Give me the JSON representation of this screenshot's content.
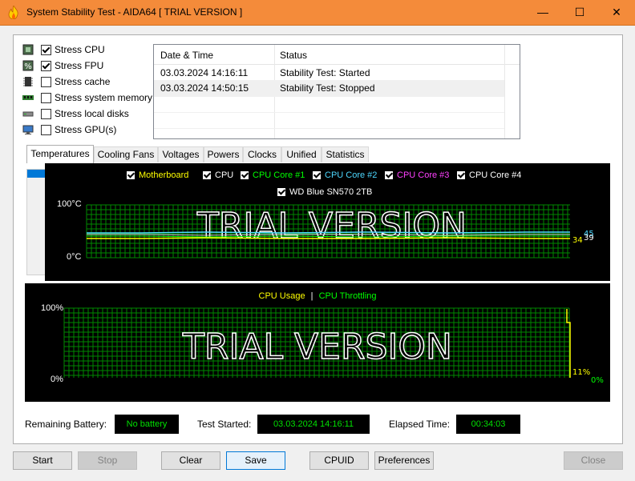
{
  "window": {
    "title": "System Stability Test - AIDA64  [ TRIAL VERSION ]",
    "min_glyph": "—",
    "max_glyph": "☐",
    "close_glyph": "✕"
  },
  "stress_options": [
    {
      "label": "Stress CPU",
      "checked": true,
      "icon": "cpu-chip-icon"
    },
    {
      "label": "Stress FPU",
      "checked": true,
      "icon": "fpu-percent-icon"
    },
    {
      "label": "Stress cache",
      "checked": false,
      "icon": "cache-chip-icon"
    },
    {
      "label": "Stress system memory",
      "checked": false,
      "icon": "memory-module-icon"
    },
    {
      "label": "Stress local disks",
      "checked": false,
      "icon": "disk-drive-icon"
    },
    {
      "label": "Stress GPU(s)",
      "checked": false,
      "icon": "monitor-icon"
    }
  ],
  "log": {
    "columns": [
      "Date & Time",
      "Status"
    ],
    "rows": [
      {
        "time": "03.03.2024 14:16:11",
        "status": "Stability Test: Started"
      },
      {
        "time": "03.03.2024 14:50:15",
        "status": "Stability Test: Stopped"
      }
    ]
  },
  "tabs": [
    "Temperatures",
    "Cooling Fans",
    "Voltages",
    "Powers",
    "Clocks",
    "Unified",
    "Statistics"
  ],
  "active_tab": "Temperatures",
  "temp_graph": {
    "legend": [
      {
        "label": "Motherboard",
        "color": "#ffff00"
      },
      {
        "label": "CPU",
        "color": "#ffffff"
      },
      {
        "label": "CPU Core #1",
        "color": "#00ff00"
      },
      {
        "label": "CPU Core #2",
        "color": "#4dd8ff"
      },
      {
        "label": "CPU Core #3",
        "color": "#ff40ff"
      },
      {
        "label": "CPU Core #4",
        "color": "#ffffff"
      },
      {
        "label": "WD Blue SN570 2TB",
        "color": "#ffffff"
      }
    ],
    "y_max_label": "100°C",
    "y_min_label": "0°C",
    "watermark": "TRIAL VERSION",
    "readouts": [
      "45",
      "39",
      "34"
    ],
    "grid_color": "#008800"
  },
  "cpu_graph": {
    "legend_usage": "CPU Usage",
    "legend_sep": "|",
    "legend_throttling": "CPU Throttling",
    "usage_color": "#ffff00",
    "throttling_color": "#00ff00",
    "y_max_label": "100%",
    "y_min_label": "0%",
    "watermark": "TRIAL VERSION",
    "usage_readout": "11%",
    "throttling_readout": "0%"
  },
  "status": {
    "battery_label": "Remaining Battery:",
    "battery_value": "No battery",
    "started_label": "Test Started:",
    "started_value": "03.03.2024 14:16:11",
    "elapsed_label": "Elapsed Time:",
    "elapsed_value": "00:34:03"
  },
  "buttons": {
    "start": "Start",
    "stop": "Stop",
    "clear": "Clear",
    "save": "Save",
    "cpuid": "CPUID",
    "preferences": "Preferences",
    "close": "Close"
  }
}
